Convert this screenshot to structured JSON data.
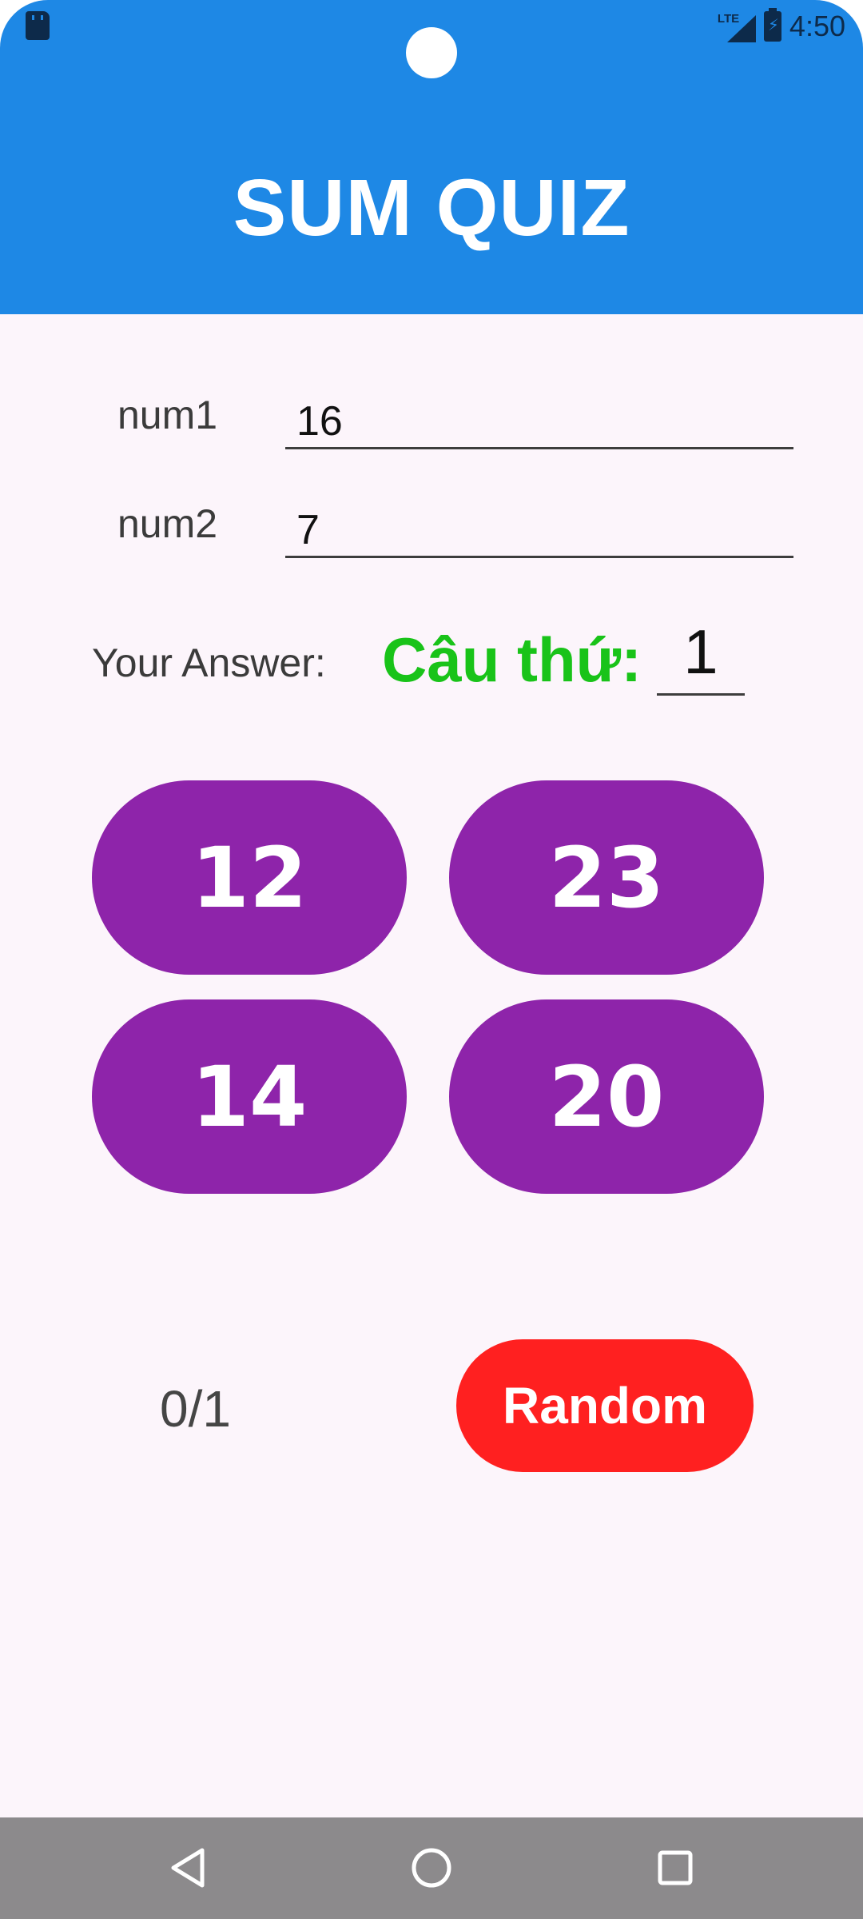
{
  "status_bar": {
    "time": "4:50",
    "network": "LTE",
    "icons": [
      "sd-card-icon",
      "signal-icon",
      "battery-charging-icon"
    ]
  },
  "app_bar": {
    "title": "SUM QUIZ",
    "color": "#1e88e5"
  },
  "form": {
    "num1_label": "num1",
    "num1_value": "16",
    "num2_label": "num2",
    "num2_value": "7",
    "answer_label": "Your Answer:",
    "question_label": "Câu thứ:",
    "question_number": "1"
  },
  "options": [
    "12",
    "23",
    "14",
    "20"
  ],
  "footer": {
    "score": "0/1",
    "random_label": "Random"
  },
  "colors": {
    "option_bg": "#8e24aa",
    "random_bg": "#ff2020",
    "question_label": "#19c319",
    "page_bg": "#fcf5fb",
    "nav_bg": "#8c8a8c"
  },
  "navigation": [
    "back-icon",
    "home-icon",
    "recents-icon"
  ]
}
